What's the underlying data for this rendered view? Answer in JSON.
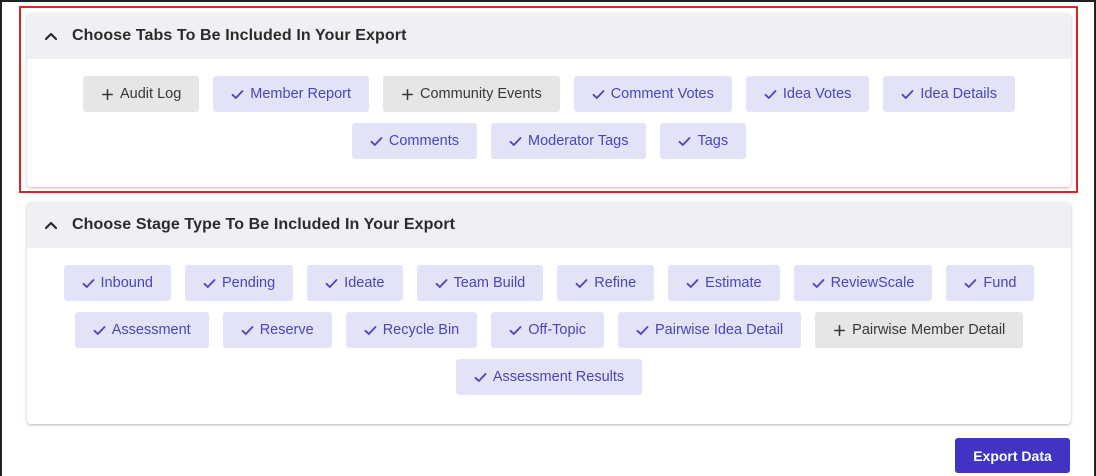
{
  "colors": {
    "selected_bg": "#e2e3f6",
    "selected_text": "#4a46b8",
    "unselected_bg": "#e6e6e6",
    "unselected_text": "#383838",
    "header_bg": "#eff0f4",
    "primary": "#4133c4",
    "highlight_border": "#e02424"
  },
  "tabs_section": {
    "title": "Choose Tabs To Be Included In Your Export",
    "collapse_icon": "chevron-up-icon",
    "rows": [
      [
        {
          "label": "Audit Log",
          "selected": false
        },
        {
          "label": "Member Report",
          "selected": true
        },
        {
          "label": "Community Events",
          "selected": false
        },
        {
          "label": "Comment Votes",
          "selected": true
        },
        {
          "label": "Idea Votes",
          "selected": true
        },
        {
          "label": "Idea Details",
          "selected": true
        }
      ],
      [
        {
          "label": "Comments",
          "selected": true
        },
        {
          "label": "Moderator Tags",
          "selected": true
        },
        {
          "label": "Tags",
          "selected": true
        }
      ]
    ]
  },
  "stages_section": {
    "title": "Choose Stage Type To Be Included In Your Export",
    "collapse_icon": "chevron-up-icon",
    "rows": [
      [
        {
          "label": "Inbound",
          "selected": true
        },
        {
          "label": "Pending",
          "selected": true
        },
        {
          "label": "Ideate",
          "selected": true
        },
        {
          "label": "Team Build",
          "selected": true
        },
        {
          "label": "Refine",
          "selected": true
        },
        {
          "label": "Estimate",
          "selected": true
        },
        {
          "label": "ReviewScale",
          "selected": true
        },
        {
          "label": "Fund",
          "selected": true
        }
      ],
      [
        {
          "label": "Assessment",
          "selected": true
        },
        {
          "label": "Reserve",
          "selected": true
        },
        {
          "label": "Recycle Bin",
          "selected": true
        },
        {
          "label": "Off-Topic",
          "selected": true
        },
        {
          "label": "Pairwise Idea Detail",
          "selected": true
        },
        {
          "label": "Pairwise Member Detail",
          "selected": false
        }
      ],
      [
        {
          "label": "Assessment Results",
          "selected": true
        }
      ]
    ]
  },
  "export_button": {
    "label": "Export Data"
  }
}
